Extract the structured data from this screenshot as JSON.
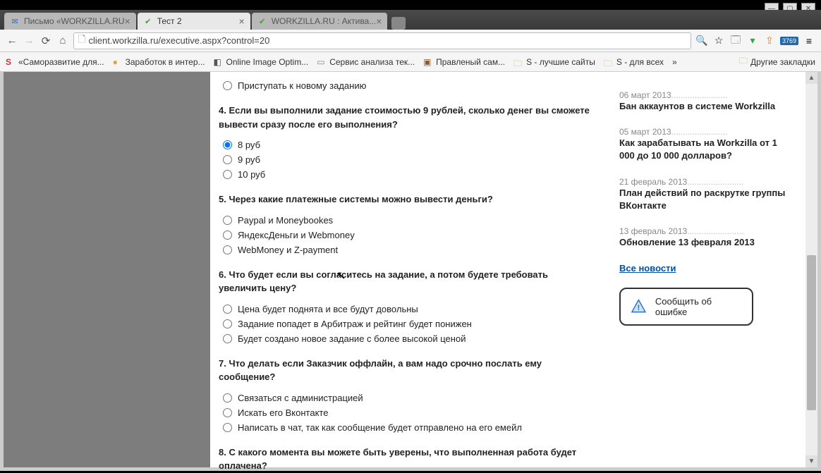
{
  "window_controls": {
    "min": "—",
    "max": "▢",
    "close": "✕"
  },
  "tabs": [
    {
      "title": "Письмо «WORKZILLA.RU",
      "active": false,
      "favicon_color": "#2a6fc9"
    },
    {
      "title": "Тест 2",
      "active": true,
      "favicon_color": "#3aa22f"
    },
    {
      "title": "WORKZILLA.RU : Актива...",
      "active": false,
      "favicon_color": "#3aa22f"
    }
  ],
  "url": "client.workzilla.ru/executive.aspx?control=20",
  "ext_badge": "3769",
  "bookmarks": {
    "items": [
      {
        "label": "«Саморазвитие для...",
        "icon": "S",
        "icon_color": "#c33"
      },
      {
        "label": "Заработок в интер...",
        "icon": "●",
        "icon_color": "#d4a83a"
      },
      {
        "label": "Online Image Optim...",
        "icon": "◧",
        "icon_color": "#555"
      },
      {
        "label": "Сервис анализа тек...",
        "icon": "▭",
        "icon_color": "#888"
      },
      {
        "label": "Правленый сам...",
        "icon": "▣",
        "icon_color": "#8a5a2a"
      },
      {
        "label": "S - лучшие сайты",
        "icon": "▀",
        "icon_color": "#d4a83a",
        "folder": true
      },
      {
        "label": "S - для всех",
        "icon": "▀",
        "icon_color": "#d4a83a",
        "folder": true
      }
    ],
    "overflow": "»",
    "other": "Другие закладки"
  },
  "quiz": {
    "q_top": {
      "options": [
        {
          "label": "Приступать к новому заданию",
          "checked": false
        }
      ]
    },
    "q4": {
      "text": "4. Если вы выполнили задание стоимостью 9 рублей, сколько денег вы сможете вывести сразу после его выполнения?",
      "options": [
        {
          "label": "8 руб",
          "checked": true
        },
        {
          "label": "9 руб",
          "checked": false
        },
        {
          "label": "10 руб",
          "checked": false
        }
      ]
    },
    "q5": {
      "text": "5. Через какие платежные системы можно вывести деньги?",
      "options": [
        {
          "label": "Paypal и Moneybookes",
          "checked": false
        },
        {
          "label": "ЯндексДеньги и Webmoney",
          "checked": false
        },
        {
          "label": "WebMoney и Z-payment",
          "checked": false
        }
      ]
    },
    "q6": {
      "text": "6. Что будет если вы согласитесь на задание, а потом будете требовать увеличить цену?",
      "options": [
        {
          "label": "Цена будет поднята и все будут довольны",
          "checked": false
        },
        {
          "label": "Задание попадет в Арбитраж и рейтинг будет понижен",
          "checked": false
        },
        {
          "label": "Будет создано новое задание с более высокой ценой",
          "checked": false
        }
      ]
    },
    "q7": {
      "text": "7. Что делать если Заказчик оффлайн, а вам надо срочно послать ему сообщение?",
      "options": [
        {
          "label": "Связаться с администрацией",
          "checked": false
        },
        {
          "label": "Искать его Вконтакте",
          "checked": false
        },
        {
          "label": "Написать в чат, так как сообщение будет отправлено на его емейл",
          "checked": false
        }
      ]
    },
    "q8": {
      "text": "8. С какого момента вы можете быть уверены, что выполненная работа будет оплачена?"
    }
  },
  "news": [
    {
      "date": "06 март 2013",
      "title": "Бан аккаунтов в системе Workzilla"
    },
    {
      "date": "05 март 2013",
      "title": "Как зарабатывать на Workzilla от 1 000 до 10 000 долларов?"
    },
    {
      "date": "21 февраль 2013",
      "title": "План действий по раскрутке группы ВКонтакте"
    },
    {
      "date": "13 февраль 2013",
      "title": "Обновление 13 февраля 2013"
    }
  ],
  "all_news": "Все новости",
  "report_error": "Сообщить об ошибке"
}
